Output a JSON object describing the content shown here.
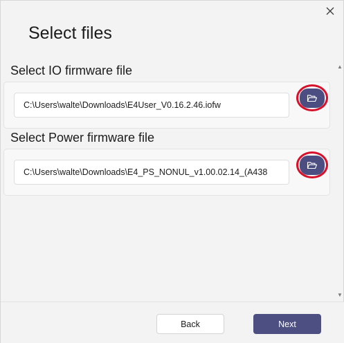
{
  "dialog": {
    "title": "Select files",
    "close_icon": "close-icon"
  },
  "io_section": {
    "heading": "Select IO firmware file",
    "path": "C:\\Users\\walte\\Downloads\\E4User_V0.16.2.46.iofw",
    "browse_icon": "folder-open-icon"
  },
  "power_section": {
    "heading": "Select Power firmware file",
    "path": "C:\\Users\\walte\\Downloads\\E4_PS_NONUL_v1.00.02.14_(A438",
    "browse_icon": "folder-open-icon"
  },
  "footer": {
    "back_label": "Back",
    "next_label": "Next"
  },
  "colors": {
    "accent": "#4d4f82",
    "highlight_ring": "#d8102a"
  }
}
